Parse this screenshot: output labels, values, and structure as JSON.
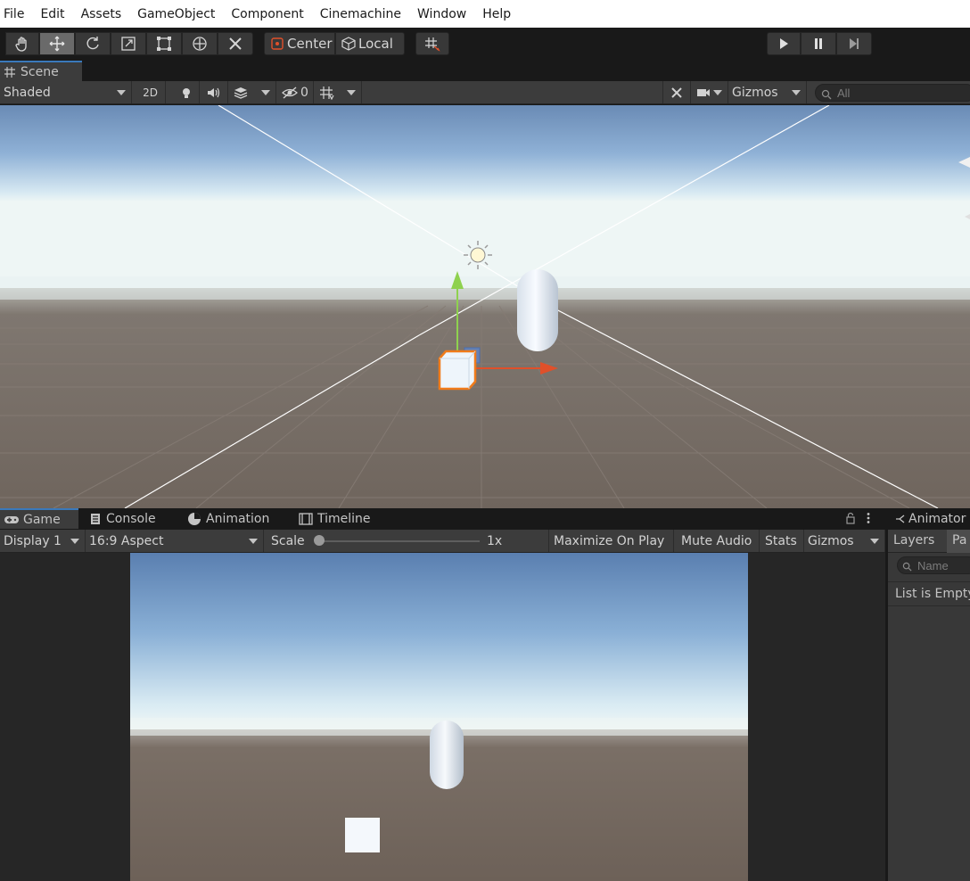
{
  "menu": [
    "File",
    "Edit",
    "Assets",
    "GameObject",
    "Component",
    "Cinemachine",
    "Window",
    "Help"
  ],
  "toolbar": {
    "tools": [
      "hand-icon",
      "move-icon",
      "rotate-icon",
      "scale-icon",
      "rect-icon",
      "transform-icon",
      "custom-tool-icon"
    ],
    "pivot_label": "Center",
    "space_label": "Local",
    "snap_icon": "grid-snap-icon",
    "play_icons": [
      "play-icon",
      "pause-icon",
      "step-icon"
    ]
  },
  "scene_tab": {
    "label": "Scene",
    "icon": "grid-icon"
  },
  "scene_bar": {
    "draw_mode": "Shaded",
    "mode_2d": "2D",
    "hidden_count": "0",
    "gizmos_label": "Gizmos",
    "search_placeholder": "All"
  },
  "bottom_tabs": [
    {
      "label": "Game",
      "icon": "gamepad-icon"
    },
    {
      "label": "Console",
      "icon": "console-icon"
    },
    {
      "label": "Animation",
      "icon": "animation-icon"
    },
    {
      "label": "Timeline",
      "icon": "timeline-icon"
    }
  ],
  "game_bar": {
    "display": "Display 1",
    "aspect": "16:9 Aspect",
    "scale_label": "Scale",
    "scale_value": "1x",
    "scale_fraction": 0.0,
    "maximize": "Maximize On Play",
    "mute": "Mute Audio",
    "stats": "Stats",
    "gizmos": "Gizmos"
  },
  "animator": {
    "tab_label": "Animator",
    "subtab_layers": "Layers",
    "subtab_params": "Pa",
    "search_placeholder": "Name",
    "empty_text": "List is Empty"
  },
  "colors": {
    "background": "#191919",
    "panel": "#3c3c3c",
    "accent": "#3a79bb",
    "axis_x": "#e0502a",
    "axis_y": "#8fd14f",
    "selection": "#f07b1a"
  }
}
